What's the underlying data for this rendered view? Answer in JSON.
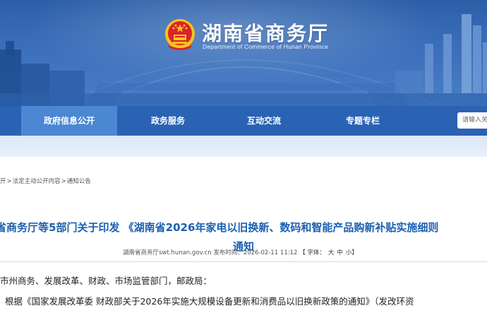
{
  "header": {
    "title": "湖南省商务厅",
    "subtitle": "Department of Commerce of Hunan Province"
  },
  "nav": {
    "items": [
      {
        "label": "政府信息公开",
        "active": true
      },
      {
        "label": "政务服务",
        "active": false
      },
      {
        "label": "互动交流",
        "active": false
      },
      {
        "label": "专题专栏",
        "active": false
      }
    ],
    "search_placeholder": "请输入关"
  },
  "breadcrumb": {
    "items": [
      "开",
      "法定主动公开内容",
      "通知公告"
    ],
    "separator": ">"
  },
  "article": {
    "title_line1": "省商务厅等5部门关于印发 《湖南省2026年家电以旧换新、数码和智能产品购新补贴实施细则",
    "title_line2": "通知",
    "meta_source": "湖南省商务厅swt.hunan.gov.cn",
    "meta_date": "发布时间：2026-02-11 11:12",
    "meta_font_label": "【 字体：",
    "meta_font_large": "大",
    "meta_font_medium": "中",
    "meta_font_small": "小",
    "meta_font_close": "】",
    "para1": "市州商务、发展改革、财政、市场监管部门，邮政局：",
    "para2": "根据《国家发展改革委 财政部关于2026年实施大规模设备更新和消费品以旧换新政策的通知》（发改环资"
  },
  "colors": {
    "nav_bg": "#2a63b4",
    "nav_active": "#4c87d3",
    "title_blue": "#1b5fb0",
    "emblem_red": "#d8232a",
    "emblem_gold": "#f5c518"
  }
}
